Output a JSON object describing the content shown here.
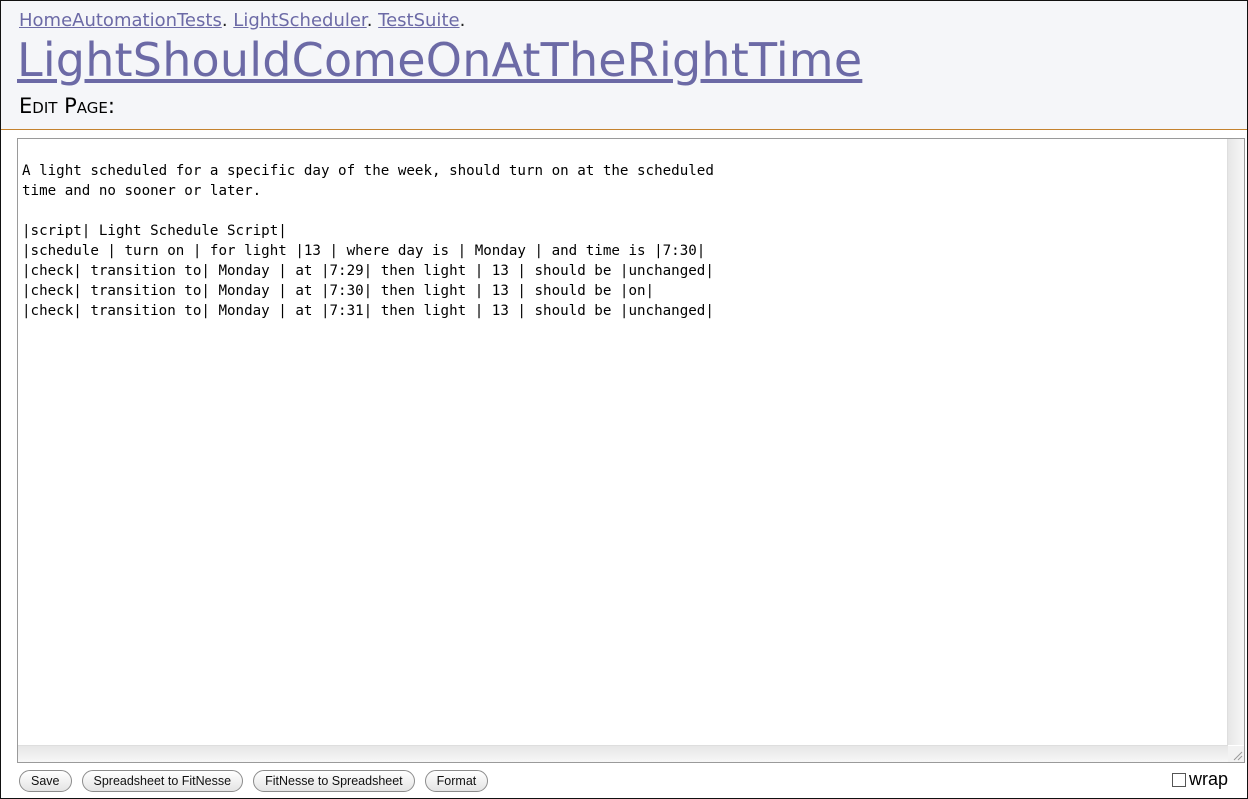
{
  "breadcrumb": {
    "items": [
      "HomeAutomationTests",
      "LightScheduler",
      "TestSuite"
    ],
    "separator": "."
  },
  "page": {
    "title": "LightShouldComeOnAtTheRightTime",
    "heading": "Edit Page:"
  },
  "editor": {
    "content": "A light scheduled for a specific day of the week, should turn on at the scheduled\ntime and no sooner or later.\n\n|script| Light Schedule Script|\n|schedule | turn on | for light |13 | where day is | Monday | and time is |7:30|\n|check| transition to| Monday | at |7:29| then light | 13 | should be |unchanged|\n|check| transition to| Monday | at |7:30| then light | 13 | should be |on|\n|check| transition to| Monday | at |7:31| then light | 13 | should be |unchanged|"
  },
  "buttons": {
    "save": "Save",
    "spreadsheet_to_fitnesse": "Spreadsheet to FitNesse",
    "fitnesse_to_spreadsheet": "FitNesse to Spreadsheet",
    "format": "Format"
  },
  "wrap": {
    "label": "wrap",
    "checked": false
  },
  "colors": {
    "link": "#6c6aa6",
    "header_rule": "#c4822f",
    "header_background": "#f5f6f9"
  }
}
